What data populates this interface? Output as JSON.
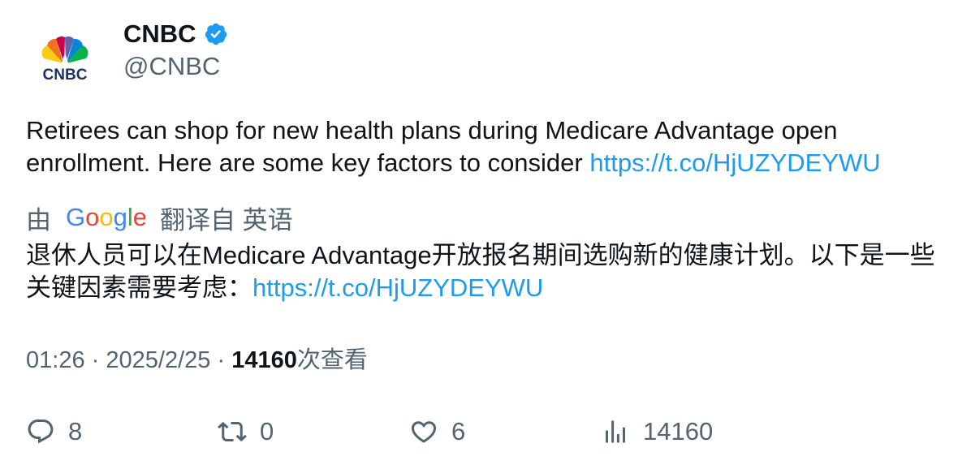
{
  "account": {
    "display_name": "CNBC",
    "handle": "@CNBC",
    "avatar_wordmark": "CNBC",
    "verified": true
  },
  "tweet": {
    "text": "Retirees can shop for new health plans during Medicare Advantage open enrollment. Here are some key factors to consider ",
    "link": "https://t.co/HjUZYDEYWU"
  },
  "translation": {
    "prefix": "由",
    "provider": "Google",
    "suffix": "翻译自 英语",
    "text": "退休人员可以在Medicare Advantage开放报名期间选购新的健康计划。以下是一些关键因素需要考虑：",
    "link": "https://t.co/HjUZYDEYWU"
  },
  "meta": {
    "time": "01:26",
    "separator": "·",
    "date": "2025/2/25",
    "views_count": "14160",
    "views_label": "次查看"
  },
  "actions": {
    "replies": "8",
    "retweets": "0",
    "likes": "6",
    "views": "14160"
  },
  "colors": {
    "text_primary": "#0f1419",
    "text_secondary": "#536471",
    "link": "#1d9bf0",
    "verified": "#1d9bf0"
  },
  "icons": {
    "verified": "verified-badge-icon",
    "reply": "reply-icon",
    "retweet": "retweet-icon",
    "like": "heart-icon",
    "views": "views-chart-icon"
  }
}
